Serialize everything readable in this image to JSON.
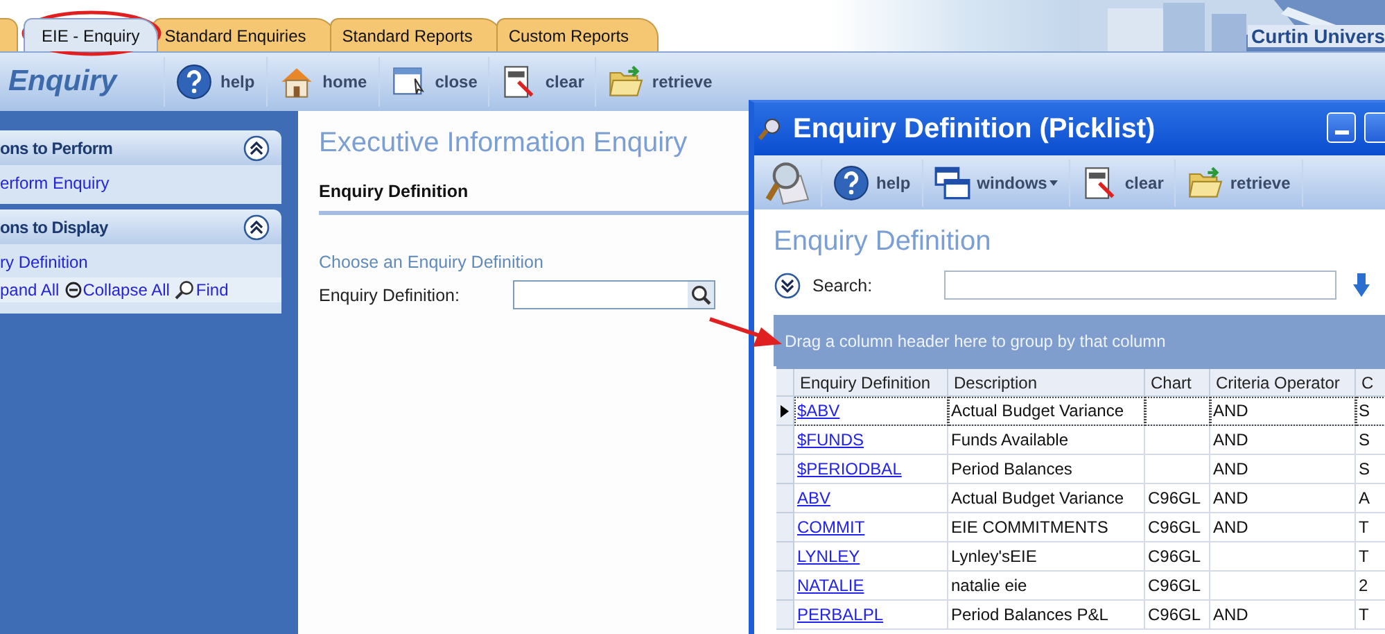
{
  "tabs": [
    {
      "label": "EIE - Enquiry",
      "selected": true
    },
    {
      "label": "Standard Enquiries",
      "selected": false
    },
    {
      "label": "Standard Reports",
      "selected": false
    },
    {
      "label": "Custom Reports",
      "selected": false
    }
  ],
  "banner": {
    "text": "Curtin Univers"
  },
  "toolbar": {
    "title": "Enquiry",
    "buttons": [
      {
        "kind": "help",
        "label": "help"
      },
      {
        "kind": "home",
        "label": "home"
      },
      {
        "kind": "close",
        "label": "close"
      },
      {
        "kind": "clear",
        "label": "clear"
      },
      {
        "kind": "retrieve",
        "label": "retrieve"
      }
    ]
  },
  "sidebar": {
    "panels": [
      {
        "title": "ons to Perform",
        "expanded": true,
        "items": [
          {
            "label": "erform Enquiry"
          }
        ]
      },
      {
        "title": "ons to Display",
        "expanded": true,
        "items": [
          {
            "label": "ry Definition"
          }
        ],
        "actions": [
          {
            "kind": "expand",
            "label": "pand All"
          },
          {
            "kind": "collapse",
            "label": "Collapse All"
          },
          {
            "kind": "find",
            "label": "Find"
          }
        ]
      }
    ]
  },
  "main": {
    "title": "Executive Information Enquiry",
    "section": "Enquiry Definition",
    "hint": "Choose an Enquiry Definition",
    "field_label": "Enquiry Definition:"
  },
  "picklist": {
    "title": "Enquiry Definition (Picklist)",
    "toolbar": [
      {
        "kind": "picklist"
      },
      {
        "kind": "help",
        "label": "help",
        "dropdown": false
      },
      {
        "kind": "windows",
        "label": "windows",
        "dropdown": true
      },
      {
        "kind": "clear",
        "label": "clear",
        "dropdown": false
      },
      {
        "kind": "retrieve",
        "label": "retrieve",
        "dropdown": false
      }
    ],
    "heading": "Enquiry Definition",
    "search": {
      "label": "Search:",
      "expanded": false
    },
    "group_hint": "Drag a column header here to group by that column",
    "table": {
      "columns": [
        "Enquiry Definition",
        "Description",
        "Chart",
        "Criteria Operator",
        "C"
      ],
      "rows": [
        {
          "enquiry_definition": "$ABV",
          "description": "Actual Budget Variance",
          "criteria_operator": "AND",
          "column_5": "S",
          "selected": true
        },
        {
          "enquiry_definition": "$FUNDS",
          "description": "Funds Available",
          "criteria_operator": "AND",
          "column_5": "S",
          "selected": false
        },
        {
          "enquiry_definition": "$PERIODBAL",
          "description": "Period Balances",
          "criteria_operator": "AND",
          "column_5": "S",
          "selected": false
        },
        {
          "enquiry_definition": "ABV",
          "description": "Actual Budget Variance",
          "chart": "C96GL",
          "criteria_operator": "AND",
          "column_5": "A",
          "selected": false
        },
        {
          "enquiry_definition": "COMMIT",
          "description": "EIE COMMITMENTS",
          "chart": "C96GL",
          "criteria_operator": "AND",
          "column_5": "T",
          "selected": false
        },
        {
          "enquiry_definition": "LYNLEY",
          "description": "Lynley'sEIE",
          "chart": "C96GL",
          "column_5": "T",
          "selected": false
        },
        {
          "enquiry_definition": "NATALIE",
          "description": "natalie eie",
          "chart": "C96GL",
          "column_5": "2",
          "selected": false
        },
        {
          "enquiry_definition": "PERBALPL",
          "description": "Period Balances P&L",
          "chart": "C96GL",
          "criteria_operator": "AND",
          "column_5": "T",
          "selected": false
        }
      ]
    }
  }
}
